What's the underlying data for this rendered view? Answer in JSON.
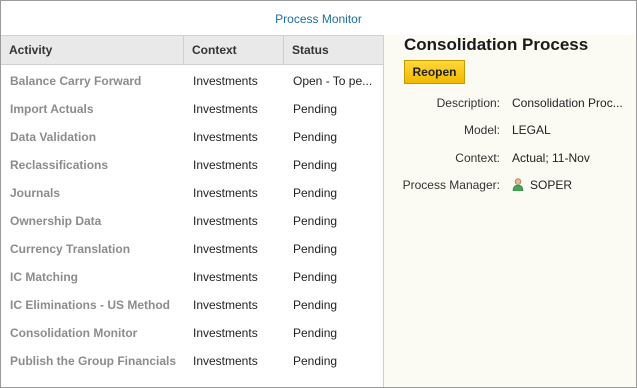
{
  "header": {
    "link": "Process Monitor"
  },
  "table": {
    "columns": [
      "Activity",
      "Context",
      "Status"
    ],
    "rows": [
      {
        "activity": "Balance Carry Forward",
        "context": "Investments",
        "status": "Open - To pe..."
      },
      {
        "activity": "Import Actuals",
        "context": "Investments",
        "status": "Pending"
      },
      {
        "activity": "Data Validation",
        "context": "Investments",
        "status": "Pending"
      },
      {
        "activity": "Reclassifications",
        "context": "Investments",
        "status": "Pending"
      },
      {
        "activity": "Journals",
        "context": "Investments",
        "status": "Pending"
      },
      {
        "activity": "Ownership Data",
        "context": "Investments",
        "status": "Pending"
      },
      {
        "activity": "Currency Translation",
        "context": "Investments",
        "status": "Pending"
      },
      {
        "activity": "IC Matching",
        "context": "Investments",
        "status": "Pending"
      },
      {
        "activity": "IC Eliminations - US Method",
        "context": "Investments",
        "status": "Pending"
      },
      {
        "activity": "Consolidation Monitor",
        "context": "Investments",
        "status": "Pending"
      },
      {
        "activity": "Publish the Group Financials",
        "context": "Investments",
        "status": "Pending"
      }
    ]
  },
  "details": {
    "title": "Consolidation Process",
    "reopen_label": "Reopen",
    "description_label": "Description:",
    "description_value": "Consolidation Proc...",
    "model_label": "Model:",
    "model_value": "LEGAL",
    "context_label": "Context:",
    "context_value": "Actual; 11-Nov",
    "manager_label": "Process Manager:",
    "manager_value": "SOPER",
    "manager_icon": "person-icon"
  },
  "colors": {
    "link": "#1f6f9a",
    "button": "#f2b800",
    "activity_text": "#8c8c8c",
    "panel_bg": "#fbfaf3"
  }
}
